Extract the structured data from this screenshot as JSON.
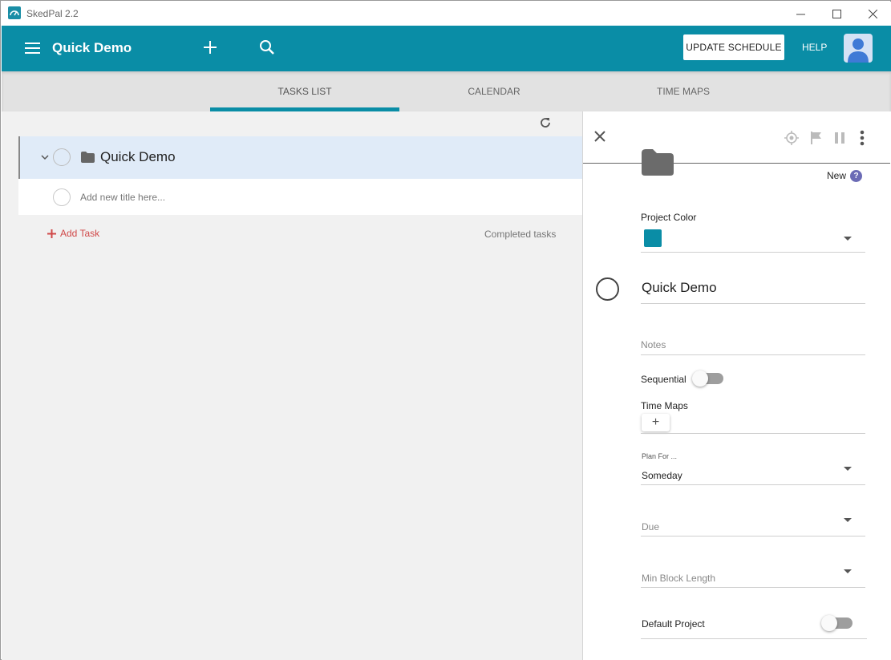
{
  "window": {
    "title": "SkedPal 2.2"
  },
  "header": {
    "title": "Quick Demo",
    "update_label": "UPDATE SCHEDULE",
    "help_label": "HELP",
    "accent": "#0a8da6"
  },
  "tabs": [
    {
      "label": "TASKS LIST",
      "active": true
    },
    {
      "label": "CALENDAR",
      "active": false
    },
    {
      "label": "TIME MAPS",
      "active": false
    }
  ],
  "tasks": {
    "project_name": "Quick Demo",
    "new_title_placeholder": "Add new title here...",
    "add_task_label": "Add Task",
    "completed_label": "Completed tasks"
  },
  "details": {
    "status": "New",
    "help_glyph": "?",
    "project_color_label": "Project Color",
    "project_color": "#0a8da6",
    "title": "Quick Demo",
    "notes_placeholder": "Notes",
    "sequential_label": "Sequential",
    "sequential_on": false,
    "time_maps_label": "Time Maps",
    "add_glyph": "+",
    "plan_for_label": "Plan For ...",
    "plan_for_value": "Someday",
    "due_placeholder": "Due",
    "min_block_placeholder": "Min Block Length",
    "default_project_label": "Default Project",
    "default_project_on": false
  },
  "icons": [
    "menu-icon",
    "add-icon",
    "search-icon",
    "refresh-icon",
    "chevron-down-icon",
    "folder-icon",
    "close-icon",
    "target-icon",
    "flag-icon",
    "pause-icon",
    "more-vert-icon",
    "help-icon",
    "dropdown-arrow-icon",
    "user-avatar-icon"
  ]
}
